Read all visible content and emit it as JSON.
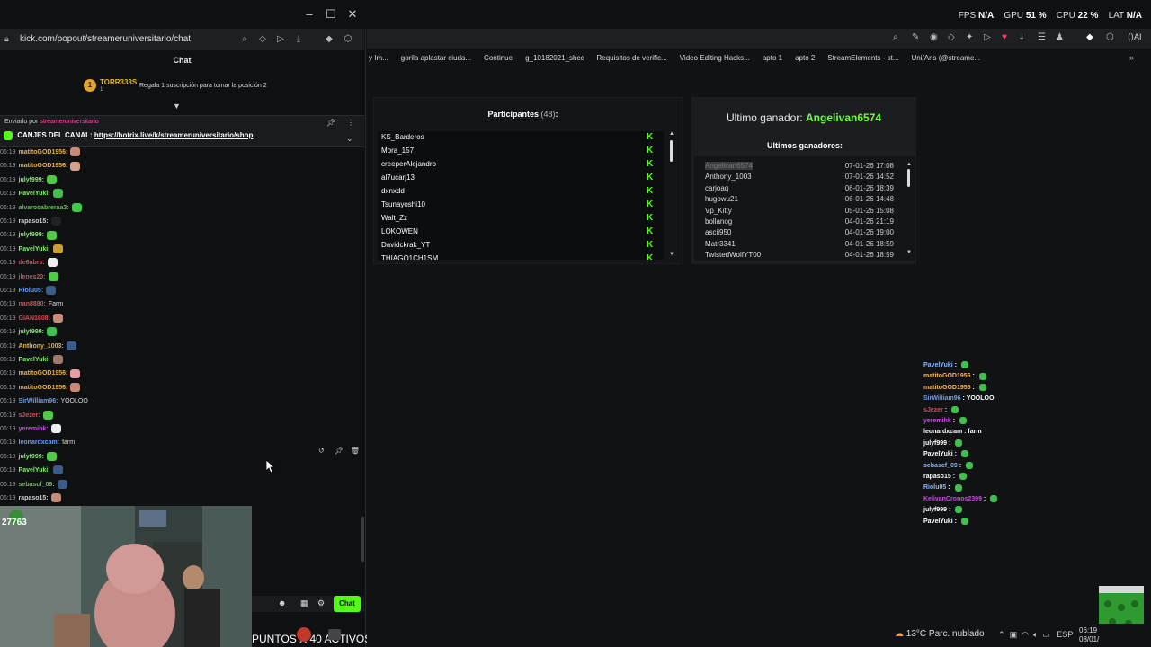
{
  "popout": {
    "url": "kick.com/popout/streameruniversitario/chat",
    "chat_title": "Chat",
    "pinned_name": "TORR333S",
    "pinned_count": "1",
    "pinned_text": "Regala 1 suscripción para tomar la posición 2",
    "sent_by_label": "Enviado por",
    "sent_by_user": "streameruniversitario",
    "canjes_label": "CANJES DEL CANAL:",
    "canjes_link": "https://botrix.live/k/streameruniversitario/shop",
    "chat_button": "Chat",
    "puntos": "PUNTOS X 40 ACTIVOS",
    "webcam_label": "27763"
  },
  "chat_messages": [
    {
      "ts": "06:19",
      "user": "matitoGOD1956:",
      "color": "#e9b04a",
      "text": "",
      "emote": "#c98a78"
    },
    {
      "ts": "06:19",
      "user": "matitoGOD1956:",
      "color": "#e9b04a",
      "text": "",
      "emote": "#d2a48c"
    },
    {
      "ts": "06:19",
      "user": "julyf999:",
      "color": "#7ef06a",
      "text": "",
      "emote": "#53c94a"
    },
    {
      "ts": "06:19",
      "user": "PavelYuki:",
      "color": "#7ef06a",
      "text": "",
      "emote": "#3fbf4c"
    },
    {
      "ts": "06:19",
      "user": "alvarocabreraa3:",
      "color": "#62c34f",
      "text": "",
      "emote": "#41c74a"
    },
    {
      "ts": "06:19",
      "user": "rapaso15:",
      "color": "#d0d0d0",
      "text": "",
      "emote": "#222"
    },
    {
      "ts": "06:19",
      "user": "julyf999:",
      "color": "#7ef06a",
      "text": "",
      "emote": "#53c94a"
    },
    {
      "ts": "06:19",
      "user": "PavelYuki:",
      "color": "#7ef06a",
      "text": "",
      "emote": "#c9a030"
    },
    {
      "ts": "06:19",
      "user": "de6abrs:",
      "color": "#e0485a",
      "text": "",
      "emote": "#eee"
    },
    {
      "ts": "06:19",
      "user": "jlenes20:",
      "color": "#e0485a",
      "text": "",
      "emote": "#53c94a"
    },
    {
      "ts": "06:19",
      "user": "Riolu05:",
      "color": "#6e9cf0",
      "text": "",
      "emote": "#3d5b8a"
    },
    {
      "ts": "06:19",
      "user": "nan8880:",
      "color": "#e0485a",
      "text": "Farm",
      "emote": ""
    },
    {
      "ts": "06:19",
      "user": "GIAN1808:",
      "color": "#e0485a",
      "text": "",
      "emote": "#c98a78"
    },
    {
      "ts": "06:19",
      "user": "julyf999:",
      "color": "#7ef06a",
      "text": "",
      "emote": "#3fbf4c"
    },
    {
      "ts": "06:19",
      "user": "Anthony_1003:",
      "color": "#e9b04a",
      "text": "",
      "emote": "#3d5b8a"
    },
    {
      "ts": "06:19",
      "user": "PavelYuki:",
      "color": "#7ef06a",
      "text": "",
      "emote": "#a07a6a"
    },
    {
      "ts": "06:19",
      "user": "matitoGOD1956:",
      "color": "#e9b04a",
      "text": "",
      "emote": "#e4a0a0"
    },
    {
      "ts": "06:19",
      "user": "matitoGOD1956:",
      "color": "#e9b04a",
      "text": "",
      "emote": "#c98a78"
    },
    {
      "ts": "06:19",
      "user": "SirWilliam96:",
      "color": "#6e9cf0",
      "text": "YOOLOO",
      "emote": ""
    },
    {
      "ts": "06:19",
      "user": "sJezer:",
      "color": "#e0485a",
      "text": "",
      "emote": "#53c94a"
    },
    {
      "ts": "06:19",
      "user": "yeremihk:",
      "color": "#c64fe0",
      "text": "",
      "emote": "#eee"
    },
    {
      "ts": "06:19",
      "user": "leonardxcam:",
      "color": "#6e9cf0",
      "text": "farm",
      "emote": ""
    },
    {
      "ts": "06:19",
      "user": "julyf999:",
      "color": "#7ef06a",
      "text": "",
      "emote": "#53c94a"
    },
    {
      "ts": "06:19",
      "user": "PavelYuki:",
      "color": "#7ef06a",
      "text": "",
      "emote": "#3d5b8a"
    },
    {
      "ts": "06:19",
      "user": "sebascf_09:",
      "color": "#62c34f",
      "text": "",
      "emote": "#3d5b8a"
    },
    {
      "ts": "06:19",
      "user": "rapaso15:",
      "color": "#d0d0d0",
      "text": "",
      "emote": "#c98a78"
    }
  ],
  "system": {
    "fps_label": "FPS",
    "fps_value": "N/A",
    "gpu_label": "GPU",
    "gpu_value": "51 %",
    "cpu_label": "CPU",
    "cpu_value": "22 %",
    "lat_label": "LAT",
    "lat_value": "N/A"
  },
  "bookmarks": [
    "y Im...",
    "gorila aplastar ciuda...",
    "Continue",
    "g_10182021_shcc",
    "Requisitos de verific...",
    "Video Editing Hacks...",
    "apto 1",
    "apto 2",
    "StreamElements - st...",
    "Uni/Aris (@streame..."
  ],
  "giveaway": {
    "participants_label": "Participantes",
    "participants_count": "(48)",
    "participants_colon": ":",
    "participants": [
      "KS_Barderos",
      "Mora_157",
      "creeperAlejandro",
      "al7ucarj13",
      "dxnxdd",
      "Tsunayoshi10",
      "Walt_Zz",
      "LOKOWEN",
      "Davidckrak_YT",
      "THIAGO1CH1SM"
    ],
    "last_winner_label": "Ultimo ganador:",
    "last_winner": "Angelivan6574",
    "winners_title": "Ultimos ganadores:",
    "winners": [
      {
        "name": "Angelivan6574",
        "date": "07-01-26 17:08"
      },
      {
        "name": "Anthony_1003",
        "date": "07-01-26 14:52"
      },
      {
        "name": "carjoaq",
        "date": "06-01-26 18:39"
      },
      {
        "name": "hugowu21",
        "date": "06-01-26 14:48"
      },
      {
        "name": "Vp_Kitty",
        "date": "05-01-26 15:08"
      },
      {
        "name": "bollanog",
        "date": "04-01-26 21:19"
      },
      {
        "name": "ascii950",
        "date": "04-01-26 19:00"
      },
      {
        "name": "Matr3341",
        "date": "04-01-26 18:59"
      },
      {
        "name": "TwistedWolfYT00",
        "date": "04-01-26 18:59"
      }
    ]
  },
  "overlay_chat": [
    {
      "user": "PavelYuki",
      "text": "",
      "color": "#8ab4ff"
    },
    {
      "user": "matitoGOD1956",
      "text": "",
      "color": "#f0b46a"
    },
    {
      "user": "matitoGOD1956",
      "text": "",
      "color": "#f0b46a"
    },
    {
      "user": "SirWilliam96",
      "text": "YOOLOO",
      "color": "#6e9cf0"
    },
    {
      "user": "sJezer",
      "text": "",
      "color": "#e0485a"
    },
    {
      "user": "yeremihk",
      "text": "",
      "color": "#c64fe0"
    },
    {
      "user": "leonardxcam",
      "text": "farm",
      "color": "#ffffff"
    },
    {
      "user": "julyf999",
      "text": "",
      "color": "#ffffff"
    },
    {
      "user": "PavelYuki",
      "text": "",
      "color": "#ffffff"
    },
    {
      "user": "sebascf_09",
      "text": "",
      "color": "#8ab4ff"
    },
    {
      "user": "rapaso15",
      "text": "",
      "color": "#ffffff"
    },
    {
      "user": "Riolu05",
      "text": "",
      "color": "#8ab4ff"
    },
    {
      "user": "KelivanCronos2399",
      "text": "",
      "color": "#c64fe0"
    },
    {
      "user": "julyf999",
      "text": "",
      "color": "#ffffff"
    },
    {
      "user": "PavelYuki",
      "text": "",
      "color": "#ffffff"
    }
  ],
  "taskbar": {
    "weather": "13°C  Parc. nublado",
    "lang": "ESP",
    "time": "06:19",
    "date": "08/01/"
  },
  "colors": {
    "kick_green": "#53fc18",
    "winner_green": "#6cff3a"
  }
}
